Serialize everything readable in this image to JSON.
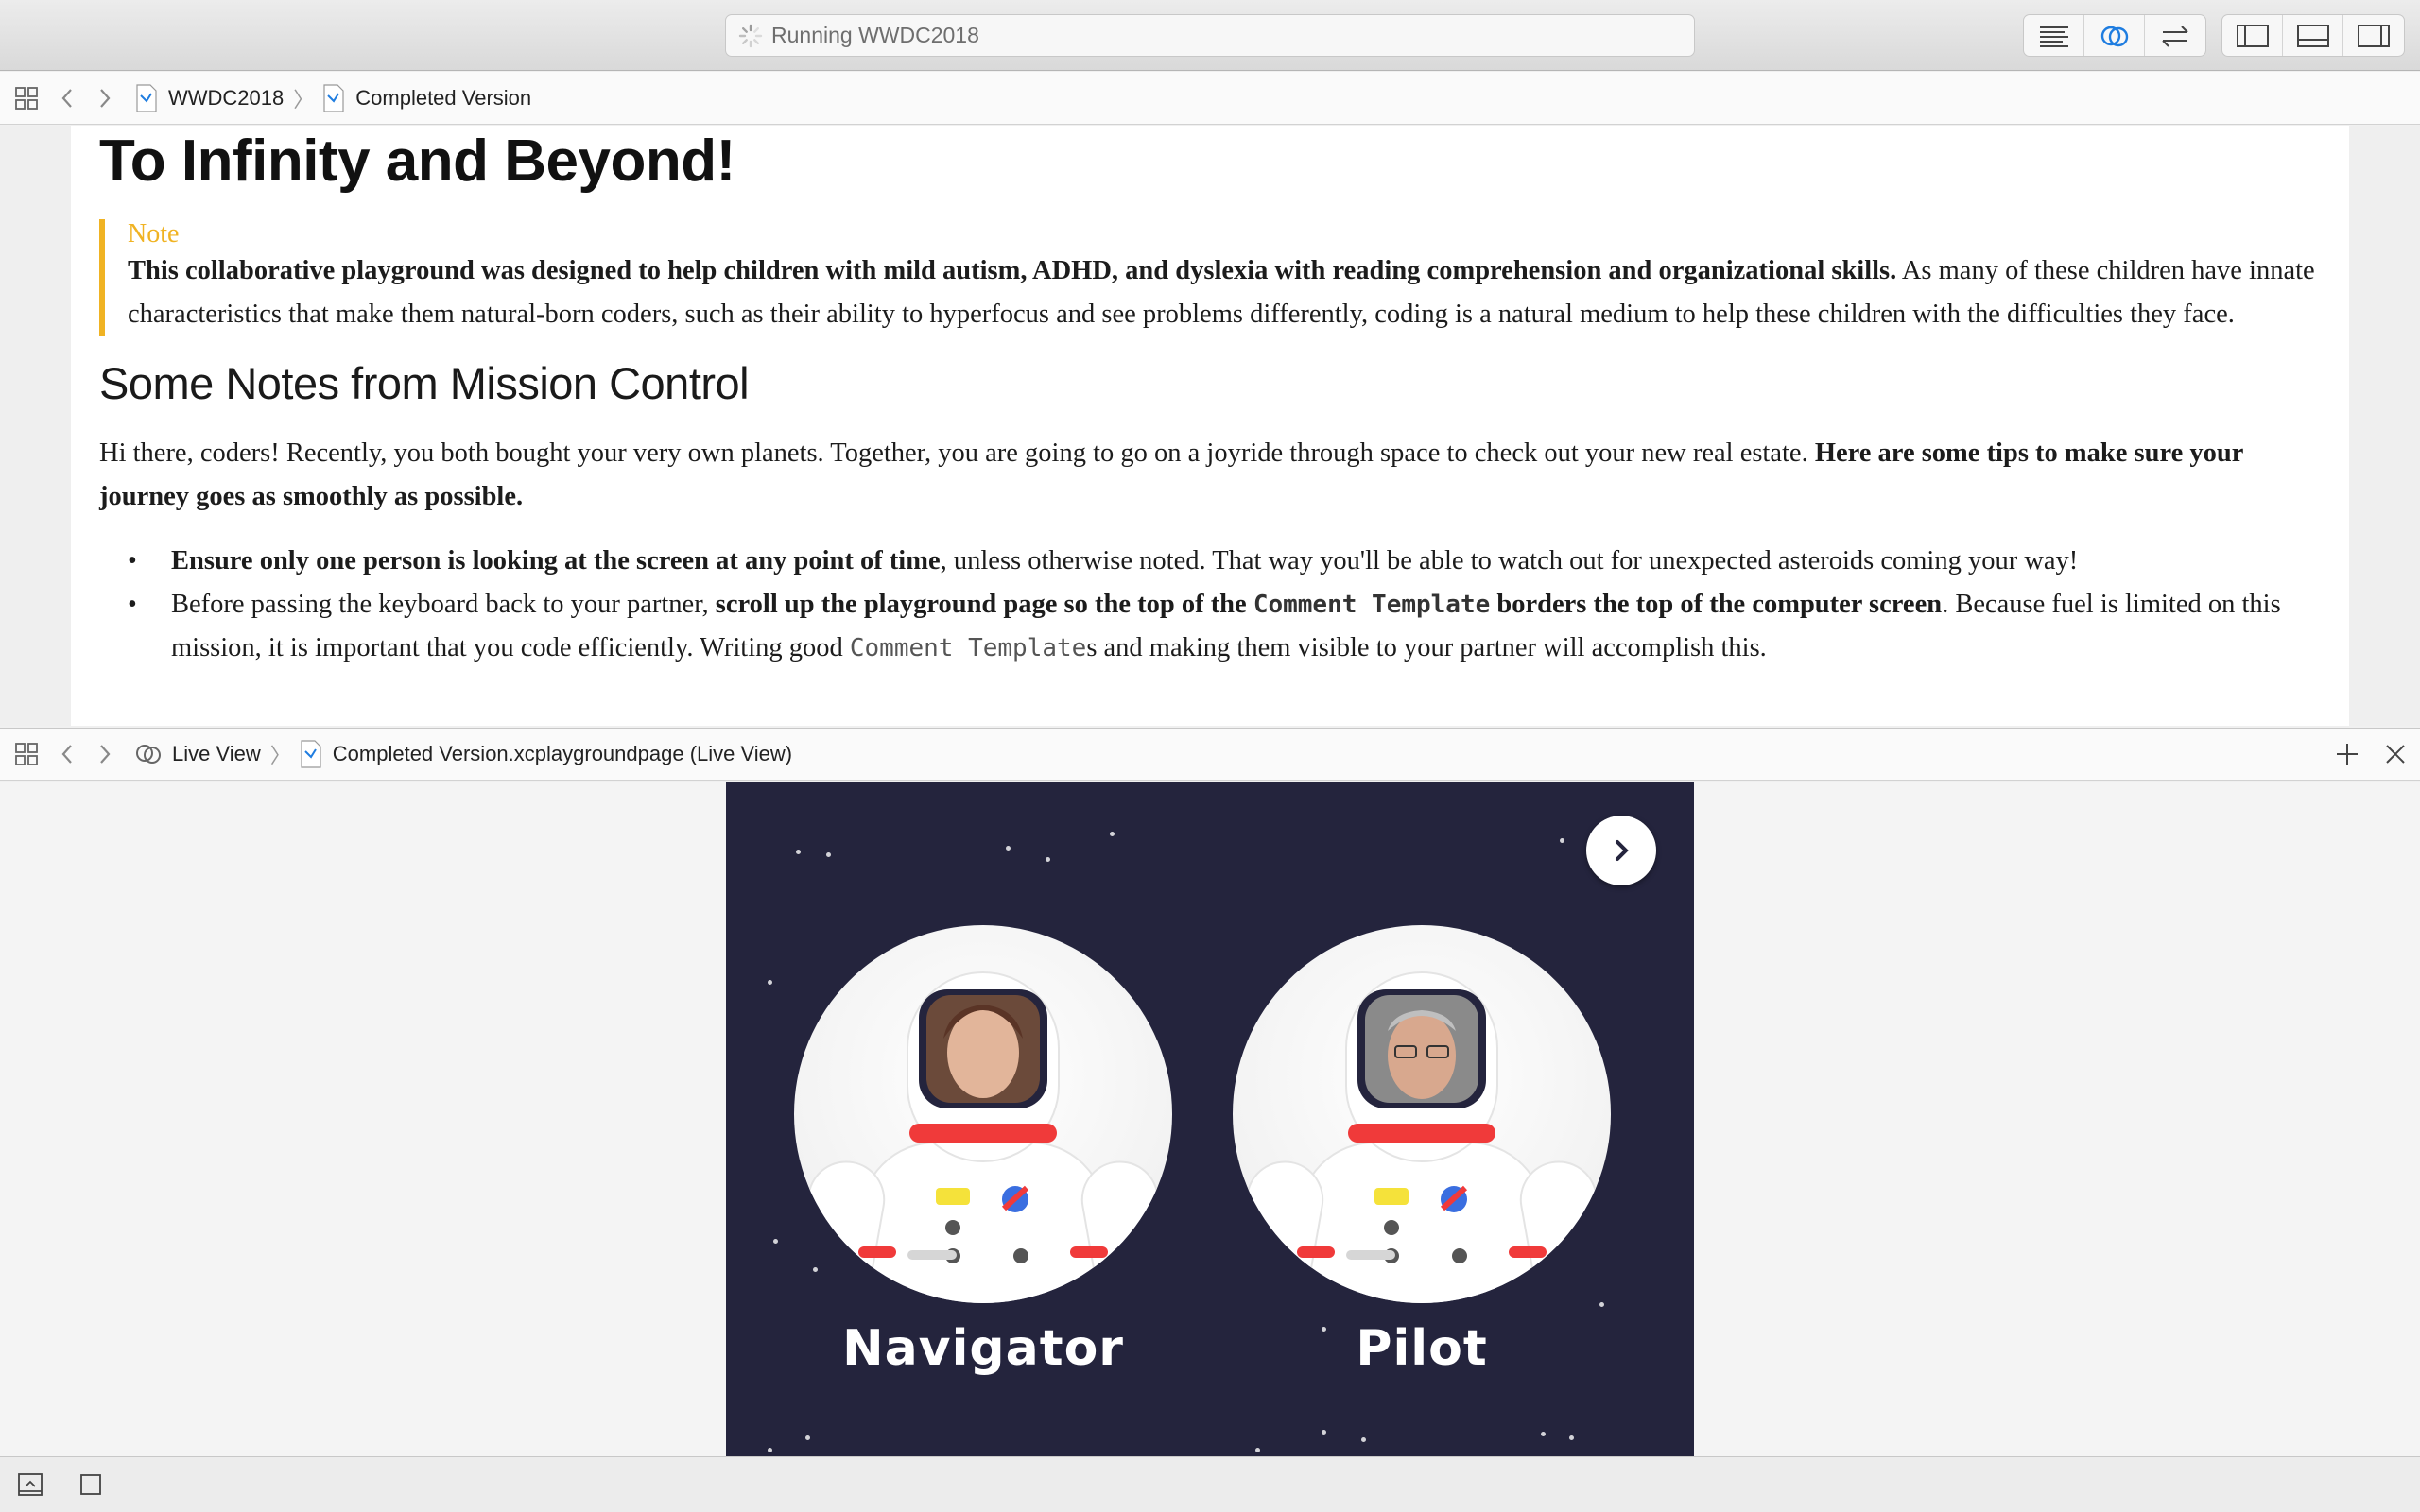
{
  "toolbar": {
    "activity_status": "Running WWDC2018"
  },
  "editor_jumpbar": {
    "crumbs": [
      "WWDC2018",
      "Completed Version"
    ]
  },
  "document": {
    "title": "To Infinity and Beyond!",
    "callout": {
      "label": "Note",
      "bold": "This collaborative playground was designed to help children with mild autism, ADHD, and dyslexia with reading comprehension and organizational skills.",
      "text": " As many of these children have innate characteristics that make them natural-born coders, such as their ability to hyperfocus and see problems differently, coding is a natural medium to help these children with the difficulties they face."
    },
    "section_title": "Some Notes from Mission Control",
    "intro": {
      "text": "Hi there, coders! Recently, you both bought your very own planets. Together, you are going to go on a joyride through space to check out your new real estate. ",
      "bold": "Here are some tips to make sure your journey goes as smoothly as possible."
    },
    "bullets": [
      {
        "bold": "Ensure only one person is looking at the screen at any point of time",
        "text": ", unless otherwise noted. That way you'll be able to watch out for unexpected asteroids coming your way!"
      },
      {
        "pre": "Before passing the keyboard back to your partner, ",
        "bold1": "scroll up the playground page so the top of the ",
        "code1": "Comment Template",
        "bold2": " borders the top of the computer screen",
        "mid": ". Because fuel is limited on this mission, it is important that you code efficiently. Writing good ",
        "code2": "Comment Template",
        "post": "s and making them visible to your partner will accomplish this."
      }
    ]
  },
  "live_jumpbar": {
    "crumbs": [
      "Live View",
      "Completed Version.xcplaygroundpage (Live View)"
    ]
  },
  "live_view": {
    "roles": [
      "Navigator",
      "Pilot"
    ],
    "colors": {
      "background": "#24243d",
      "suit_red": "#f03a3a",
      "badge_yellow": "#f5e23a"
    }
  },
  "colors": {
    "note_accent": "#f0b323"
  }
}
